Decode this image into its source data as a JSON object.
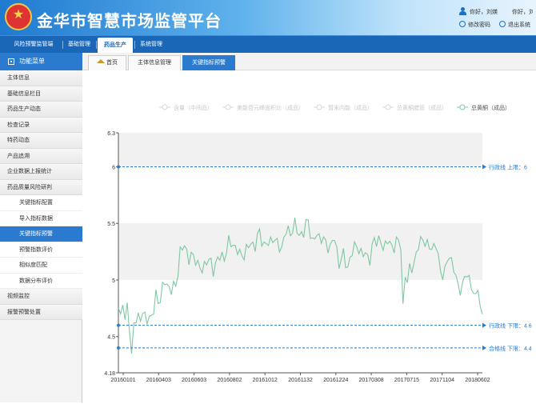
{
  "header": {
    "title": "金华市智慧市场监管平台",
    "greeting": "你好，刘煐",
    "hello_suffix": "你好，刘煐",
    "change_password": "修改密码",
    "logout": "退出系统"
  },
  "nav": {
    "items": [
      {
        "label": "风险预警监管端"
      },
      {
        "label": "基础管理"
      },
      {
        "label": "药品生产"
      },
      {
        "label": "系统管理"
      }
    ]
  },
  "sidebar": {
    "title": "功能菜单",
    "items": [
      {
        "label": "主体信息"
      },
      {
        "label": "基础信息栏目"
      },
      {
        "label": "药品生产动态"
      },
      {
        "label": "检查记录"
      },
      {
        "label": "特药动态"
      },
      {
        "label": "产品追溯"
      },
      {
        "label": "企业数据上报统计"
      },
      {
        "label": "药品质量风险研判"
      },
      {
        "label": "关键指标配置"
      },
      {
        "label": "导入指标数据"
      },
      {
        "label": "关键指标预警"
      },
      {
        "label": "预警指数评价"
      },
      {
        "label": "相似度匹配"
      },
      {
        "label": "数据分布评价"
      },
      {
        "label": "视频监控"
      },
      {
        "label": "报警预警处置"
      }
    ]
  },
  "tabs": [
    {
      "label": "首页"
    },
    {
      "label": "主体信息管理"
    },
    {
      "label": "关键指标预警"
    }
  ],
  "chart_data": {
    "type": "line",
    "legend": [
      {
        "name": "含量（中间品）",
        "active": false
      },
      {
        "name": "美能苷元峰面积比（成品）",
        "active": false
      },
      {
        "name": "暂未内能（成品）",
        "active": false
      },
      {
        "name": "总黄酮腊管（成品）",
        "active": false
      },
      {
        "name": "总黄酮（成品）",
        "active": true
      }
    ],
    "legend_placement": "top",
    "x_ticks": [
      "20160101",
      "20160403",
      "20160603",
      "20160802",
      "20161012",
      "20161132",
      "20161224",
      "20170308",
      "20170715",
      "20171104",
      "20180602"
    ],
    "ylim": [
      4.18,
      6.3
    ],
    "y_ticks": [
      4.18,
      4.5,
      5,
      5.5,
      6,
      6.3
    ],
    "bands": [
      [
        5.0,
        5.5
      ],
      [
        6.0,
        6.3
      ]
    ],
    "ref_lines": [
      {
        "label": "行政线 上限：6",
        "value": 6
      },
      {
        "label": "行政线 下限：4.6",
        "value": 4.6
      },
      {
        "label": "合格线 下限：4.4",
        "value": 4.4
      }
    ],
    "series_color": "#7fc8a2",
    "anchors": [
      [
        0,
        4.75
      ],
      [
        1,
        4.7
      ],
      [
        2,
        4.78
      ],
      [
        3,
        4.65
      ],
      [
        4,
        4.8
      ],
      [
        5,
        4.55
      ],
      [
        6,
        4.35
      ],
      [
        7,
        4.62
      ],
      [
        8,
        4.62
      ],
      [
        9,
        4.64
      ],
      [
        10,
        4.66
      ],
      [
        12,
        4.65
      ],
      [
        14,
        4.7
      ],
      [
        16,
        4.75
      ],
      [
        17,
        4.88
      ],
      [
        19,
        4.8
      ],
      [
        21,
        4.95
      ],
      [
        24,
        4.92
      ],
      [
        26,
        5.0
      ],
      [
        28,
        5.25
      ],
      [
        30,
        5.28
      ],
      [
        32,
        5.15
      ],
      [
        35,
        5.22
      ],
      [
        38,
        5.1
      ],
      [
        40,
        5.18
      ],
      [
        43,
        5.05
      ],
      [
        45,
        5.2
      ],
      [
        48,
        5.25
      ],
      [
        50,
        5.33
      ],
      [
        52,
        5.28
      ],
      [
        55,
        5.2
      ],
      [
        58,
        5.3
      ],
      [
        60,
        5.35
      ],
      [
        62,
        5.28
      ],
      [
        64,
        5.38
      ],
      [
        66,
        5.3
      ],
      [
        68,
        5.35
      ],
      [
        70,
        5.42
      ],
      [
        72,
        5.3
      ],
      [
        74,
        5.25
      ],
      [
        76,
        5.4
      ],
      [
        78,
        5.45
      ],
      [
        80,
        5.52
      ],
      [
        82,
        5.42
      ],
      [
        84,
        5.38
      ],
      [
        86,
        5.5
      ],
      [
        88,
        5.32
      ],
      [
        90,
        5.45
      ],
      [
        92,
        5.4
      ],
      [
        94,
        5.3
      ],
      [
        96,
        5.25
      ],
      [
        98,
        5.35
      ],
      [
        100,
        5.18
      ],
      [
        102,
        5.25
      ],
      [
        104,
        5.12
      ],
      [
        106,
        5.2
      ],
      [
        108,
        5.3
      ],
      [
        110,
        5.22
      ],
      [
        112,
        5.3
      ],
      [
        114,
        5.18
      ],
      [
        116,
        5.35
      ],
      [
        118,
        5.3
      ],
      [
        120,
        5.28
      ],
      [
        122,
        5.4
      ],
      [
        124,
        5.3
      ],
      [
        126,
        5.35
      ],
      [
        128,
        5.25
      ],
      [
        129,
        4.72
      ],
      [
        130,
        5.05
      ],
      [
        131,
        4.98
      ],
      [
        132,
        5.1
      ],
      [
        134,
        5.2
      ],
      [
        136,
        5.3
      ],
      [
        138,
        5.35
      ],
      [
        140,
        5.25
      ],
      [
        142,
        5.3
      ],
      [
        144,
        5.35
      ],
      [
        146,
        5.1
      ],
      [
        148,
        5.05
      ],
      [
        150,
        5.18
      ],
      [
        152,
        5.1
      ],
      [
        154,
        4.95
      ],
      [
        156,
        5.0
      ],
      [
        158,
        5.05
      ],
      [
        160,
        4.92
      ],
      [
        162,
        4.78
      ],
      [
        163,
        4.95
      ],
      [
        164,
        4.8
      ],
      [
        165,
        4.7
      ],
      [
        166,
        4.6
      ]
    ],
    "n_points": 166
  }
}
